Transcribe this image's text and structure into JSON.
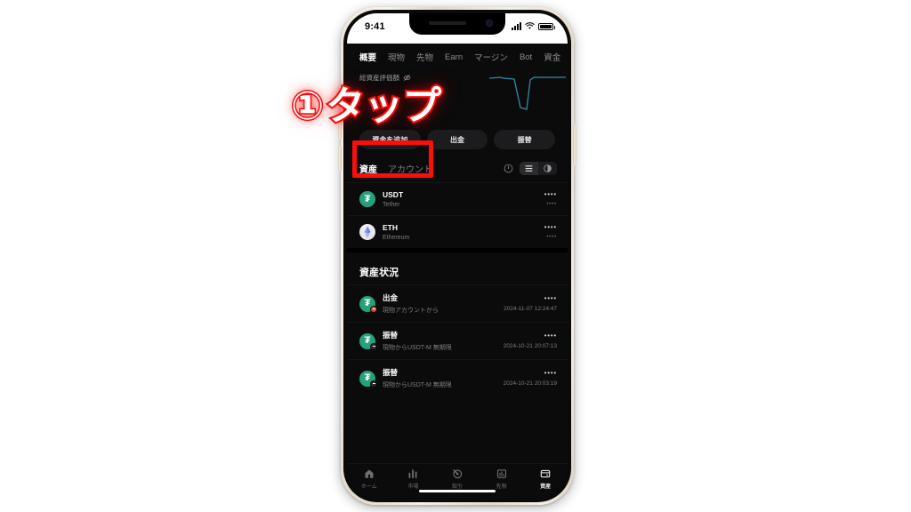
{
  "annotation": {
    "step_number": "①",
    "instruction": "タップ",
    "color": "#fd0d0d"
  },
  "status_bar": {
    "time": "9:41",
    "signal_icon": "cellular-bars-icon",
    "wifi_icon": "wifi-icon",
    "battery_icon": "battery-icon"
  },
  "top_tabs": [
    {
      "label": "概要",
      "active": true
    },
    {
      "label": "現物",
      "active": false
    },
    {
      "label": "先物",
      "active": false
    },
    {
      "label": "Earn",
      "active": false
    },
    {
      "label": "マージン",
      "active": false
    },
    {
      "label": "Bot",
      "active": false
    },
    {
      "label": "資金",
      "active": false
    }
  ],
  "balance": {
    "label": "総資産評価額",
    "hide_icon": "eye-off-icon",
    "value": "",
    "sparkline_color": "#2d8fa3"
  },
  "actions": [
    {
      "label": "資金を追加",
      "highlighted": true
    },
    {
      "label": "出金",
      "highlighted": false
    },
    {
      "label": "振替",
      "highlighted": false
    }
  ],
  "assets_section": {
    "tabs": [
      {
        "label": "資産",
        "active": true
      },
      {
        "label": "アカウント",
        "active": false
      }
    ],
    "info_icon": "info-circle-icon",
    "view_list_icon": "list-view-icon",
    "view_chart_icon": "pie-chart-icon",
    "rows": [
      {
        "symbol": "USDT",
        "name": "Tether",
        "amount": "••••",
        "sub_amount": "••••",
        "icon": "usdt-coin-icon"
      },
      {
        "symbol": "ETH",
        "name": "Ethereum",
        "amount": "••••",
        "sub_amount": "••••",
        "icon": "eth-coin-icon"
      }
    ]
  },
  "history_section": {
    "title": "資産状況",
    "rows": [
      {
        "type": "出金",
        "detail": "現物アカウントから",
        "amount": "••••",
        "timestamp": "2024-11-07 12:24:47",
        "badge": "withdraw-badge"
      },
      {
        "type": "振替",
        "detail": "現物からUSDT-M 無期限",
        "amount": "••••",
        "timestamp": "2024-10-21 20:07:13",
        "badge": "transfer-badge"
      },
      {
        "type": "振替",
        "detail": "現物からUSDT-M 無期限",
        "amount": "••••",
        "timestamp": "2024-10-21 20:03:19",
        "badge": "transfer-badge"
      }
    ]
  },
  "bottom_nav": [
    {
      "label": "ホーム",
      "icon": "home-icon",
      "active": false
    },
    {
      "label": "市場",
      "icon": "markets-bars-icon",
      "active": false
    },
    {
      "label": "取引",
      "icon": "trade-icon",
      "active": false
    },
    {
      "label": "先物",
      "icon": "futures-icon",
      "active": false
    },
    {
      "label": "資産",
      "icon": "wallet-icon",
      "active": true
    }
  ]
}
